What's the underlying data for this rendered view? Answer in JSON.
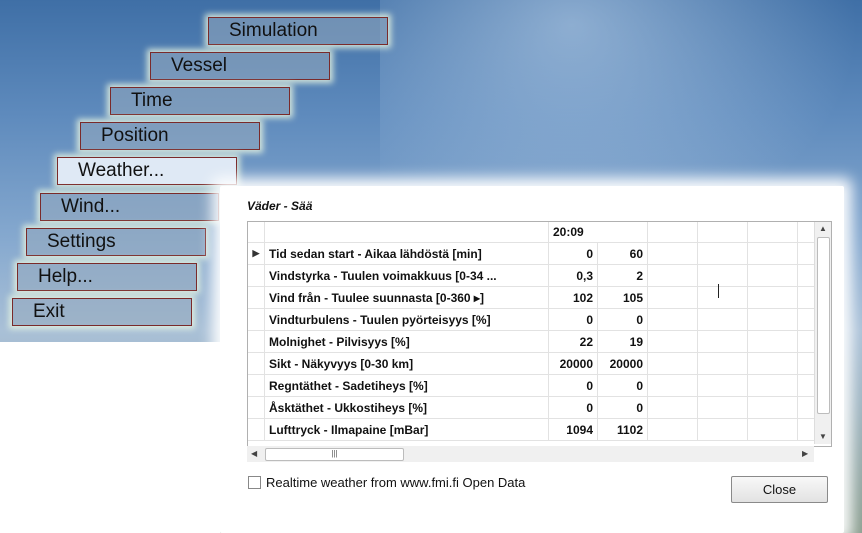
{
  "menu": {
    "items": [
      {
        "label": "Simulation",
        "id": "simulation"
      },
      {
        "label": "Vessel",
        "id": "vessel"
      },
      {
        "label": "Time",
        "id": "time"
      },
      {
        "label": "Position",
        "id": "position"
      },
      {
        "label": "Weather...",
        "id": "weather",
        "active": true
      },
      {
        "label": "Wind...",
        "id": "wind"
      },
      {
        "label": "Settings",
        "id": "settings"
      },
      {
        "label": "Help...",
        "id": "help"
      },
      {
        "label": "Exit",
        "id": "exit"
      }
    ]
  },
  "weather_panel": {
    "title": "Väder - Sää",
    "grid": {
      "time_header": "20:09",
      "rows": [
        {
          "label": "Tid sedan start - Aikaa lähdöstä [min]",
          "v1": "0",
          "v2": "60",
          "current": true
        },
        {
          "label": "Vindstyrka - Tuulen voimakkuus [0-34 ...",
          "v1": "0,3",
          "v2": "2"
        },
        {
          "label": "Vind från - Tuulee suunnasta [0-360 ▸]",
          "v1": "102",
          "v2": "105"
        },
        {
          "label": "Vindturbulens - Tuulen pyörteisyys [%]",
          "v1": "0",
          "v2": "0"
        },
        {
          "label": "Molnighet - Pilvisyys [%]",
          "v1": "22",
          "v2": "19"
        },
        {
          "label": "Sikt - Näkyvyys [0-30 km]",
          "v1": "20000",
          "v2": "20000"
        },
        {
          "label": "Regntäthet - Sadetiheys [%]",
          "v1": "0",
          "v2": "0"
        },
        {
          "label": "Åsktäthet - Ukkostiheys [%]",
          "v1": "0",
          "v2": "0"
        },
        {
          "label": "Lufttryck - Ilmapaine [mBar]",
          "v1": "1094",
          "v2": "1102"
        }
      ]
    },
    "realtime_checkbox": {
      "label": "Realtime weather from www.fmi.fi Open Data",
      "checked": false
    },
    "close_label": "Close"
  }
}
